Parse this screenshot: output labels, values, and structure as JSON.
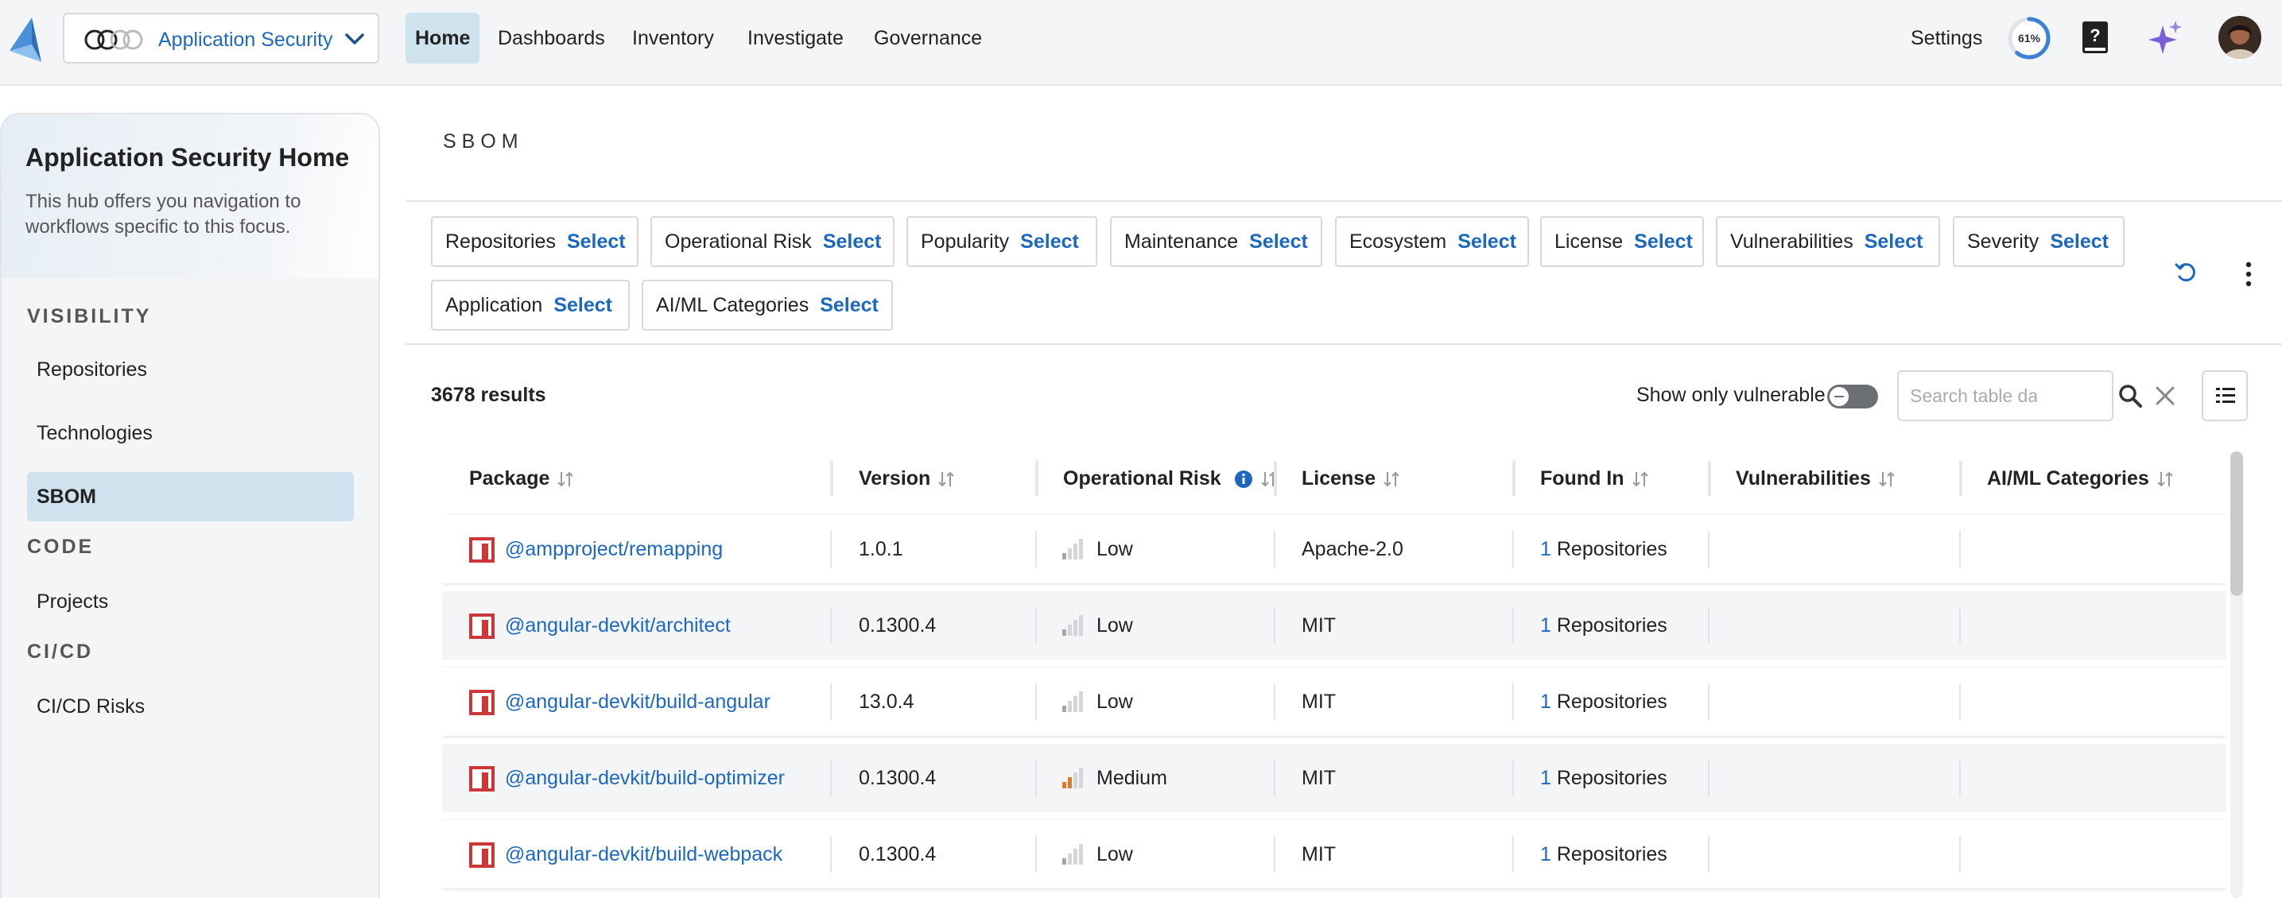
{
  "app": {
    "switcher_label": "Application Security"
  },
  "nav": {
    "items": [
      {
        "label": "Home",
        "active": true
      },
      {
        "label": "Dashboards"
      },
      {
        "label": "Inventory"
      },
      {
        "label": "Investigate"
      },
      {
        "label": "Governance"
      }
    ],
    "settings_label": "Settings",
    "progress_label": "61%",
    "progress_value": 0.61
  },
  "sidebar": {
    "hub_title": "Application Security Home",
    "hub_desc": "This hub offers you navigation to workflows specific to this focus.",
    "sections": [
      {
        "title": "VISIBILITY",
        "items": [
          "Repositories",
          "Technologies",
          "SBOM"
        ]
      },
      {
        "title": "CODE",
        "items": [
          "Projects"
        ]
      },
      {
        "title": "CI/CD",
        "items": [
          "CI/CD Risks"
        ]
      }
    ],
    "active_item": "SBOM"
  },
  "page": {
    "heading": "SBOM"
  },
  "filters": {
    "select_label": "Select",
    "chips": [
      "Repositories",
      "Operational Risk",
      "Popularity",
      "Maintenance",
      "Ecosystem",
      "License",
      "Vulnerabilities",
      "Severity",
      "Application",
      "AI/ML Categories"
    ]
  },
  "toolbar": {
    "results": "3678 results",
    "vulnerable_toggle_label": "Show only vulnerable",
    "vulnerable_toggle_on": false,
    "search_placeholder": "Search table data..."
  },
  "table": {
    "columns": [
      "Package",
      "Version",
      "Operational Risk",
      "License",
      "Found In",
      "Vulnerabilities",
      "AI/ML Categories"
    ],
    "rows": [
      {
        "package": "@ampproject/remapping",
        "version": "1.0.1",
        "risk": "Low",
        "license": "Apache-2.0",
        "found_count": "1",
        "found_label": "Repositories",
        "vulnerabilities": "",
        "ai_ml": ""
      },
      {
        "package": "@angular-devkit/architect",
        "version": "0.1300.4",
        "risk": "Low",
        "license": "MIT",
        "found_count": "1",
        "found_label": "Repositories",
        "vulnerabilities": "",
        "ai_ml": ""
      },
      {
        "package": "@angular-devkit/build-angular",
        "version": "13.0.4",
        "risk": "Low",
        "license": "MIT",
        "found_count": "1",
        "found_label": "Repositories",
        "vulnerabilities": "",
        "ai_ml": ""
      },
      {
        "package": "@angular-devkit/build-optimizer",
        "version": "0.1300.4",
        "risk": "Medium",
        "license": "MIT",
        "found_count": "1",
        "found_label": "Repositories",
        "vulnerabilities": "",
        "ai_ml": ""
      },
      {
        "package": "@angular-devkit/build-webpack",
        "version": "0.1300.4",
        "risk": "Low",
        "license": "MIT",
        "found_count": "1",
        "found_label": "Repositories",
        "vulnerabilities": "",
        "ai_ml": ""
      }
    ]
  },
  "colors": {
    "accent": "#1c67c0",
    "active_bg": "#cfe3ee",
    "npm_red": "#cb3837",
    "risk_low": "#a3a6ab",
    "risk_medium": "#e07b2c",
    "ai_purple": "#7b5fd9"
  },
  "icons": {
    "logo": "logo-icon",
    "help": "help-book-icon",
    "ai": "sparkles-icon",
    "search": "search-icon",
    "clear": "close-icon",
    "columns": "columns-icon",
    "undo": "undo-icon",
    "more": "kebab-icon",
    "package": "npm-icon",
    "risk": "signal-bars-icon",
    "sort": "sort-icon",
    "info": "info-icon"
  }
}
